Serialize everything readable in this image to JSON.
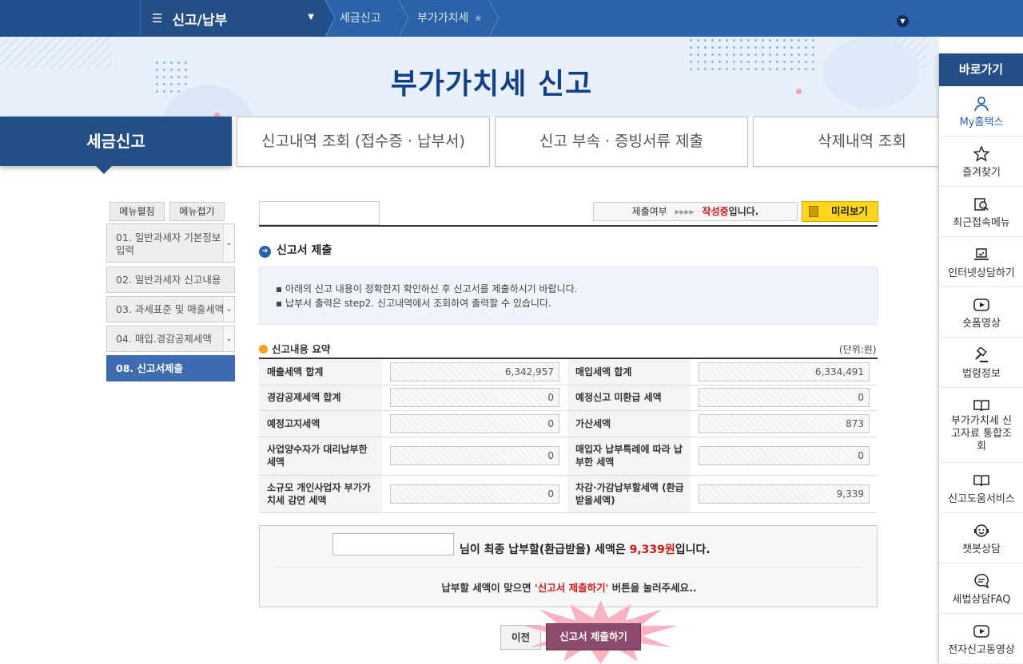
{
  "topnav": {
    "menu_label": "신고/납부",
    "crumbs": [
      "세금신고",
      "부가가치세"
    ]
  },
  "banner": {
    "title": "부가가치세 신고"
  },
  "tabs": [
    {
      "label": "세금신고",
      "active": true
    },
    {
      "label": "신고내역 조회 (접수증 · 납부서)"
    },
    {
      "label": "신고 부속 · 증빙서류 제출"
    },
    {
      "label": "삭제내역 조회"
    }
  ],
  "sidemenu": {
    "expand_label": "메뉴펼침",
    "collapse_label": "메뉴접기",
    "items": [
      {
        "label": "01. 일반과세자 기본정보 입력"
      },
      {
        "label": "02. 일반과세자 신고내용"
      },
      {
        "label": "03. 과세표준 및 매출세액"
      },
      {
        "label": "04. 매입.경감공제세액"
      },
      {
        "label": "08. 신고서제출"
      }
    ]
  },
  "status": {
    "prefix": "제출여부",
    "arrows": "▸▸▸▸",
    "state": "작성중",
    "suffix": "입니다."
  },
  "preview_label": "미리보기",
  "section": {
    "title": "신고서 제출",
    "notices": [
      "아래의 신고 내용이 정확한지 확인하신 후 신고서를 제출하시기 바랍니다.",
      "납부서 출력은 step2. 신고내역에서 조회하여 출력할 수 있습니다."
    ]
  },
  "summary": {
    "title": "신고내용 요약",
    "unit": "(단위:원)",
    "rows": [
      {
        "l1": "매출세액 합계",
        "v1": "6,342,957",
        "l2": "매입세액 합계",
        "v2": "6,334,491"
      },
      {
        "l1": "경감공제세액 합계",
        "v1": "0",
        "l2": "예정신고 미환급 세액",
        "v2": "0"
      },
      {
        "l1": "예정고지세액",
        "v1": "0",
        "l2": "가산세액",
        "v2": "873"
      },
      {
        "l1": "사업양수자가 대리납부한 세액",
        "v1": "0",
        "l2": "매입자 납부특례에 따라 납부한 세액",
        "v2": "0"
      },
      {
        "l1": "소규모 개인사업자 부가가치세 감면 세액",
        "v1": "0",
        "l2": "차감·가감납부할세액 (환급받을세액)",
        "v2": "9,339"
      }
    ]
  },
  "final": {
    "msg_prefix": "님이 최종 납부할(환급받을) 세액은 ",
    "amount": "9,339원",
    "msg_suffix": "입니다.",
    "confirm_prefix": "납부할 세액이 맞으면 ",
    "confirm_highlight": "'신고서 제출하기'",
    "confirm_suffix": " 버튼을 눌러주세요.."
  },
  "buttons": {
    "prev": "이전",
    "submit": "신고서 제출하기"
  },
  "quick": {
    "title": "바로가기",
    "items": [
      {
        "label": "My홈택스",
        "icon": "user-icon"
      },
      {
        "label": "즐겨찾기",
        "icon": "star-icon"
      },
      {
        "label": "최근접속메뉴",
        "icon": "recent-search-icon"
      },
      {
        "label": "인터넷상담하기",
        "icon": "laptop-icon"
      },
      {
        "label": "숏폼영상",
        "icon": "play-icon"
      },
      {
        "label": "법령정보",
        "icon": "gavel-icon"
      },
      {
        "label": "부가가치세 신고자료 통합조회",
        "icon": "book-icon"
      },
      {
        "label": "신고도움서비스",
        "icon": "book-icon"
      },
      {
        "label": "챗봇상담",
        "icon": "chatbot-icon"
      },
      {
        "label": "세법상담FAQ",
        "icon": "chat-icon"
      },
      {
        "label": "전자신고동영상",
        "icon": "play-icon"
      }
    ]
  }
}
